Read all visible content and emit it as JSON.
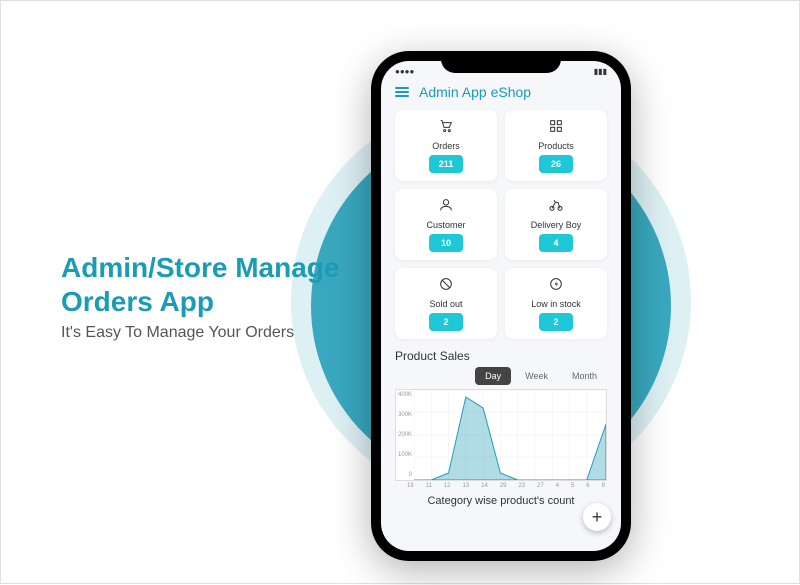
{
  "marketing": {
    "heading_line1": "Admin/Store Manage",
    "heading_line2": "Orders App",
    "subtitle": "It's Easy To Manage Your Orders"
  },
  "appbar": {
    "title": "Admin App eShop"
  },
  "cards": [
    {
      "label": "Orders",
      "value": "211"
    },
    {
      "label": "Products",
      "value": "26"
    },
    {
      "label": "Customer",
      "value": "10"
    },
    {
      "label": "Delivery Boy",
      "value": "4"
    },
    {
      "label": "Sold out",
      "value": "2"
    },
    {
      "label": "Low in stock",
      "value": "2"
    }
  ],
  "sales": {
    "section_title": "Product Sales",
    "tabs": [
      "Day",
      "Week",
      "Month"
    ],
    "active_tab": "Day",
    "footer_title": "Category wise product's count"
  },
  "chart_data": {
    "type": "area",
    "title": "Product Sales",
    "xlabel": "",
    "ylabel": "",
    "ylim": [
      0,
      400000
    ],
    "y_ticks": [
      "400K",
      "300K",
      "200K",
      "100K",
      "0"
    ],
    "categories": [
      "19",
      "11",
      "12",
      "13",
      "14",
      "29",
      "23",
      "27",
      "4",
      "5",
      "6",
      "8"
    ],
    "values": [
      0,
      0,
      30000,
      370000,
      320000,
      30000,
      0,
      0,
      0,
      0,
      0,
      250000
    ]
  },
  "fab": {
    "label": "+"
  }
}
